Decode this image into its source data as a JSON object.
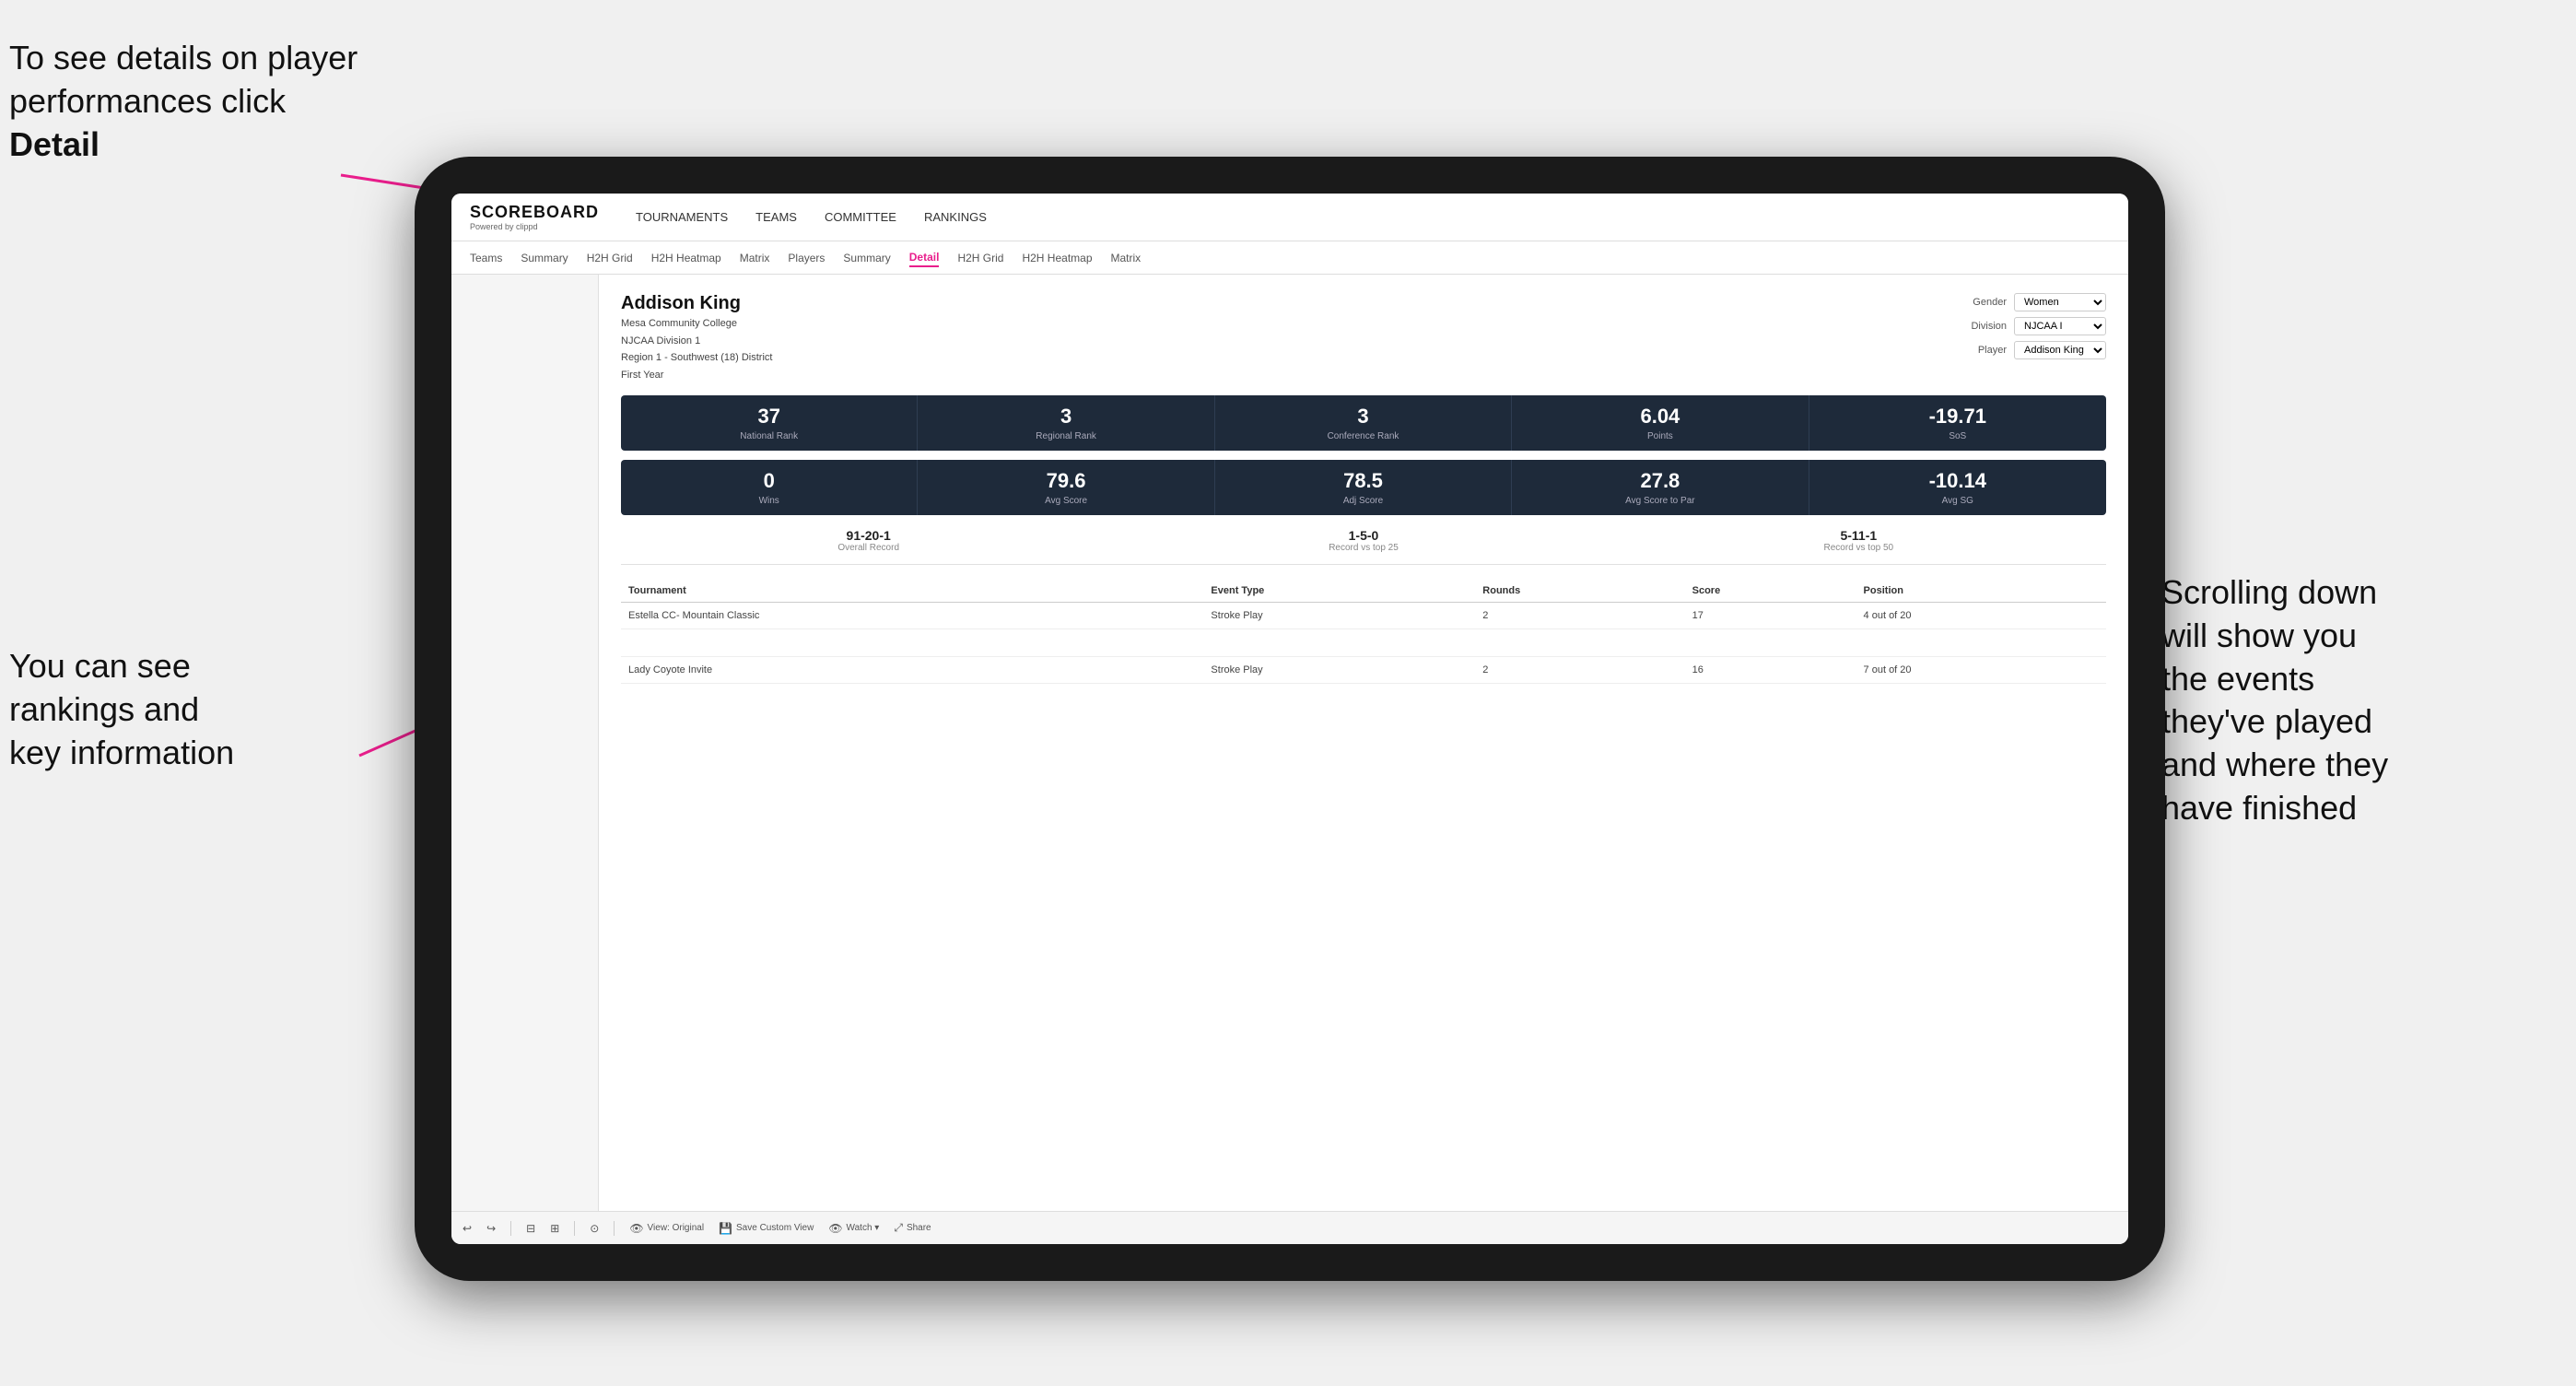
{
  "annotations": {
    "topleft": "To see details on player performances click Detail",
    "topleft_bold": "Detail",
    "bottomleft_line1": "You can see",
    "bottomleft_line2": "rankings and",
    "bottomleft_line3": "key information",
    "bottomright_line1": "Scrolling down",
    "bottomright_line2": "will show you",
    "bottomright_line3": "the events",
    "bottomright_line4": "they've played",
    "bottomright_line5": "and where they",
    "bottomright_line6": "have finished"
  },
  "nav": {
    "logo": "SCOREBOARD",
    "logo_sub": "Powered by clippd",
    "items": [
      {
        "label": "TOURNAMENTS",
        "active": false
      },
      {
        "label": "TEAMS",
        "active": false
      },
      {
        "label": "COMMITTEE",
        "active": false
      },
      {
        "label": "RANKINGS",
        "active": false
      }
    ]
  },
  "subnav": {
    "items": [
      {
        "label": "Teams",
        "active": false
      },
      {
        "label": "Summary",
        "active": false
      },
      {
        "label": "H2H Grid",
        "active": false
      },
      {
        "label": "H2H Heatmap",
        "active": false
      },
      {
        "label": "Matrix",
        "active": false
      },
      {
        "label": "Players",
        "active": false
      },
      {
        "label": "Summary",
        "active": false
      },
      {
        "label": "Detail",
        "active": true
      },
      {
        "label": "H2H Grid",
        "active": false
      },
      {
        "label": "H2H Heatmap",
        "active": false
      },
      {
        "label": "Matrix",
        "active": false
      }
    ]
  },
  "player": {
    "name": "Addison King",
    "college": "Mesa Community College",
    "division": "NJCAA Division 1",
    "region": "Region 1 - Southwest (18) District",
    "year": "First Year"
  },
  "selectors": {
    "gender_label": "Gender",
    "gender_value": "Women",
    "division_label": "Division",
    "division_value": "NJCAA I",
    "player_label": "Player",
    "player_value": "Addison King"
  },
  "stats_row1": [
    {
      "value": "37",
      "label": "National Rank"
    },
    {
      "value": "3",
      "label": "Regional Rank"
    },
    {
      "value": "3",
      "label": "Conference Rank"
    },
    {
      "value": "6.04",
      "label": "Points"
    },
    {
      "value": "-19.71",
      "label": "SoS"
    }
  ],
  "stats_row2": [
    {
      "value": "0",
      "label": "Wins"
    },
    {
      "value": "79.6",
      "label": "Avg Score"
    },
    {
      "value": "78.5",
      "label": "Adj Score"
    },
    {
      "value": "27.8",
      "label": "Avg Score to Par"
    },
    {
      "value": "-10.14",
      "label": "Avg SG"
    }
  ],
  "records": [
    {
      "value": "91-20-1",
      "label": "Overall Record"
    },
    {
      "value": "1-5-0",
      "label": "Record vs top 25"
    },
    {
      "value": "5-11-1",
      "label": "Record vs top 50"
    }
  ],
  "table": {
    "headers": [
      "Tournament",
      "Event Type",
      "Rounds",
      "Score",
      "Position"
    ],
    "rows": [
      {
        "tournament": "Estella CC- Mountain Classic",
        "event_type": "Stroke Play",
        "rounds": "2",
        "score": "17",
        "position": "4 out of 20"
      },
      {
        "tournament": "",
        "event_type": "",
        "rounds": "",
        "score": "",
        "position": ""
      },
      {
        "tournament": "Lady Coyote Invite",
        "event_type": "Stroke Play",
        "rounds": "2",
        "score": "16",
        "position": "7 out of 20"
      }
    ]
  },
  "toolbar": {
    "items": [
      {
        "icon": "↩",
        "label": ""
      },
      {
        "icon": "↪",
        "label": ""
      },
      {
        "icon": "⊞",
        "label": ""
      },
      {
        "icon": "⊟",
        "label": ""
      },
      {
        "icon": "—",
        "label": ""
      },
      {
        "icon": "+",
        "label": ""
      },
      {
        "icon": "⊙",
        "label": ""
      },
      {
        "icon": "👁",
        "label": "View: Original"
      },
      {
        "icon": "💾",
        "label": "Save Custom View"
      },
      {
        "icon": "👁",
        "label": "Watch ▾"
      },
      {
        "icon": "▭",
        "label": ""
      },
      {
        "icon": "⊞",
        "label": ""
      },
      {
        "icon": "⤢",
        "label": "Share"
      }
    ]
  }
}
